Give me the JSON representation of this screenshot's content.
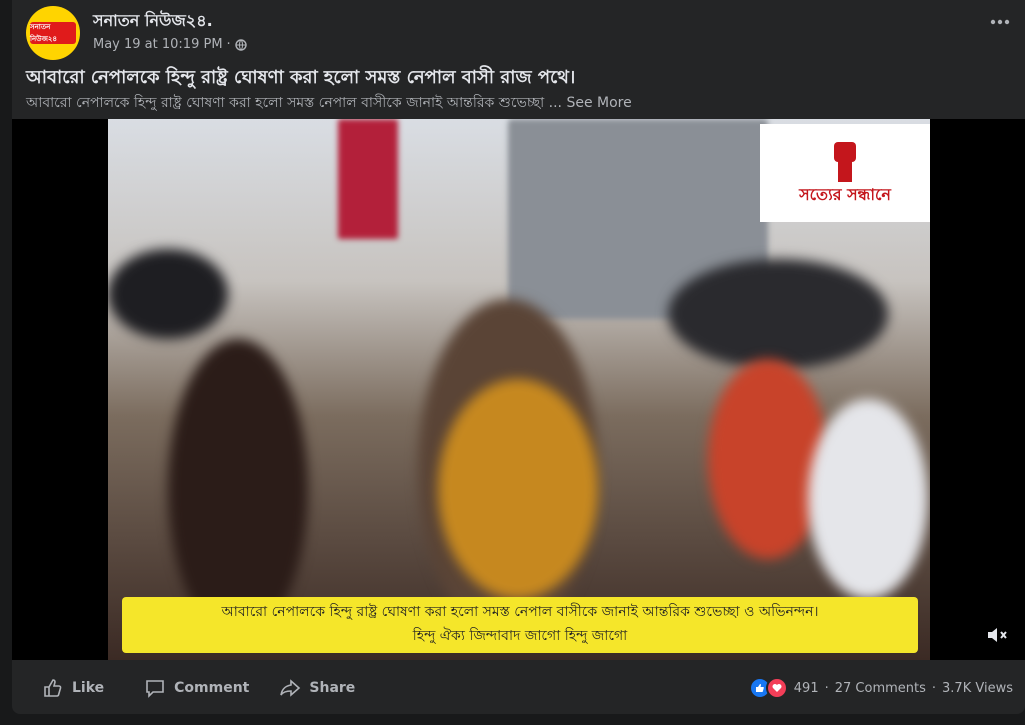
{
  "post": {
    "page_name": "সনাতন নিউজ২৪.",
    "timestamp": "May 19 at 10:19 PM",
    "separator": "·",
    "avatar_text": "সনাতন নিউজ২৪",
    "title": "আবারো নেপালকে হিন্দু রাষ্ট্র ঘোষণা করা হলো সমস্ত নেপাল বাসী রাজ পথে।",
    "text": "আবারো নেপালকে হিন্দু রাষ্ট্র ঘোষণা করা হলো সমস্ত নেপাল বাসীকে জানাই আন্তরিক শুভেচ্ছা ...",
    "see_more": "See More"
  },
  "video": {
    "watermark_text": "সত্যের সন্ধানে",
    "caption_line1": "আবারো নেপালকে হিন্দু রাষ্ট্র ঘোষণা করা হলো সমস্ত নেপাল বাসীকে জানাই আন্তরিক শুভেচ্ছা ও অভিনন্দন।",
    "caption_line2": "হিন্দু ঐক্য জিন্দাবাদ জাগো হিন্দু জাগো",
    "mute_icon": "speaker-muted-icon"
  },
  "actions": {
    "like_label": "Like",
    "comment_label": "Comment",
    "share_label": "Share"
  },
  "stats": {
    "reaction_count": "491",
    "comments": "27 Comments",
    "views": "3.7K Views",
    "dot": "·"
  },
  "colors": {
    "background": "#18191a",
    "card": "#242526",
    "caption_bg": "#f5e62a",
    "like_blue": "#1877f2",
    "love_red": "#f33e58"
  }
}
